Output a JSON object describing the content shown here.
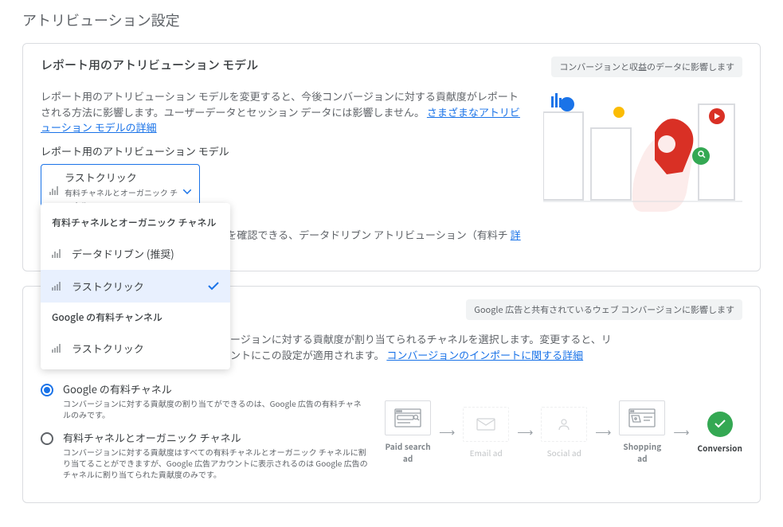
{
  "page_title": "アトリビューション設定",
  "card1": {
    "title": "レポート用のアトリビューション モデル",
    "badge": "コンバージョンと収益のデータに影響します",
    "desc": "レポート用のアトリビューション モデルを変更すると、今後コンバージョンに対する貢献度がレポートされる方法に影響します。ユーザーデータとセッション データには影響しません。",
    "desc_link": "さまざまなアトリビューション モデルの詳細",
    "label": "レポート用のアトリビューション モデル",
    "select": {
      "main": "ラストクリック",
      "sub": "有料チャネルとオーガニック チャネル"
    },
    "dropdown": {
      "group1": "有料チャネルとオーガニック チャネル",
      "opt1": "データドリブン (推奨)",
      "opt2": "ラストクリック",
      "group2": "Google の有料チャンネル",
      "opt3": "ラストクリック"
    },
    "note_partial": "トがコンバージョンの成果に与える影響を確認できる、データドリブン アトリビューション（有料チ",
    "note_more": "詳細"
  },
  "card2": {
    "badge": "Google 広告と共有されているウェブ コンバージョンに影響します",
    "desc_partial": "ージョンに対する貢献度が割り当てられるチャネルを選択します。変更すると、リ",
    "desc_partial2": "ントにこの設定が適用されます。",
    "desc_link": "コンバージョンのインポートに関する詳細",
    "radio1": {
      "title": "Google の有料チャネル",
      "desc": "コンバージョンに対する貢献度の割り当てができるのは、Google 広告の有料チャネルのみです。"
    },
    "radio2": {
      "title": "有料チャネルとオーガニック チャネル",
      "desc": "コンバージョンに対する貢献度はすべての有料チャネルとオーガニック チャネルに割り当てることができますが、Google 広告アカウントに表示されるのは Google 広告のチャネルに割り当てられた貢献度のみです。"
    },
    "funnel": {
      "s1": "Paid search ad",
      "s2": "Email ad",
      "s3": "Social ad",
      "s4": "Shopping ad",
      "s5": "Conversion"
    }
  }
}
